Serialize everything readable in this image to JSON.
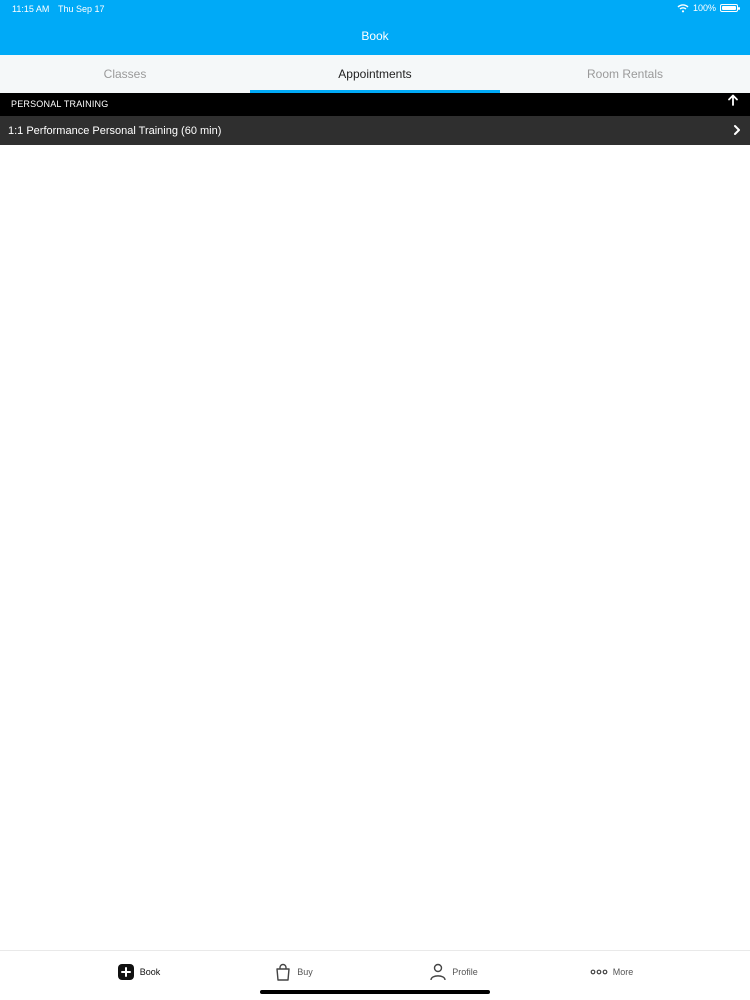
{
  "status_bar": {
    "time": "11:15 AM",
    "date": "Thu Sep 17",
    "battery": "100%"
  },
  "header": {
    "title": "Book"
  },
  "tabs": [
    {
      "label": "Classes",
      "active": false
    },
    {
      "label": "Appointments",
      "active": true
    },
    {
      "label": "Room Rentals",
      "active": false
    }
  ],
  "section": {
    "title": "PERSONAL TRAINING"
  },
  "items": [
    {
      "label": "1:1 Performance Personal Training (60 min)"
    }
  ],
  "tabbar": {
    "items": [
      {
        "label": "Book",
        "icon": "plus-square-icon"
      },
      {
        "label": "Buy",
        "icon": "shopping-bag-icon"
      },
      {
        "label": "Profile",
        "icon": "person-icon"
      },
      {
        "label": "More",
        "icon": "more-dots-icon"
      }
    ]
  },
  "colors": {
    "accent": "#00aaf7",
    "section_bg": "#000000",
    "item_bg": "#2f2f2f"
  }
}
